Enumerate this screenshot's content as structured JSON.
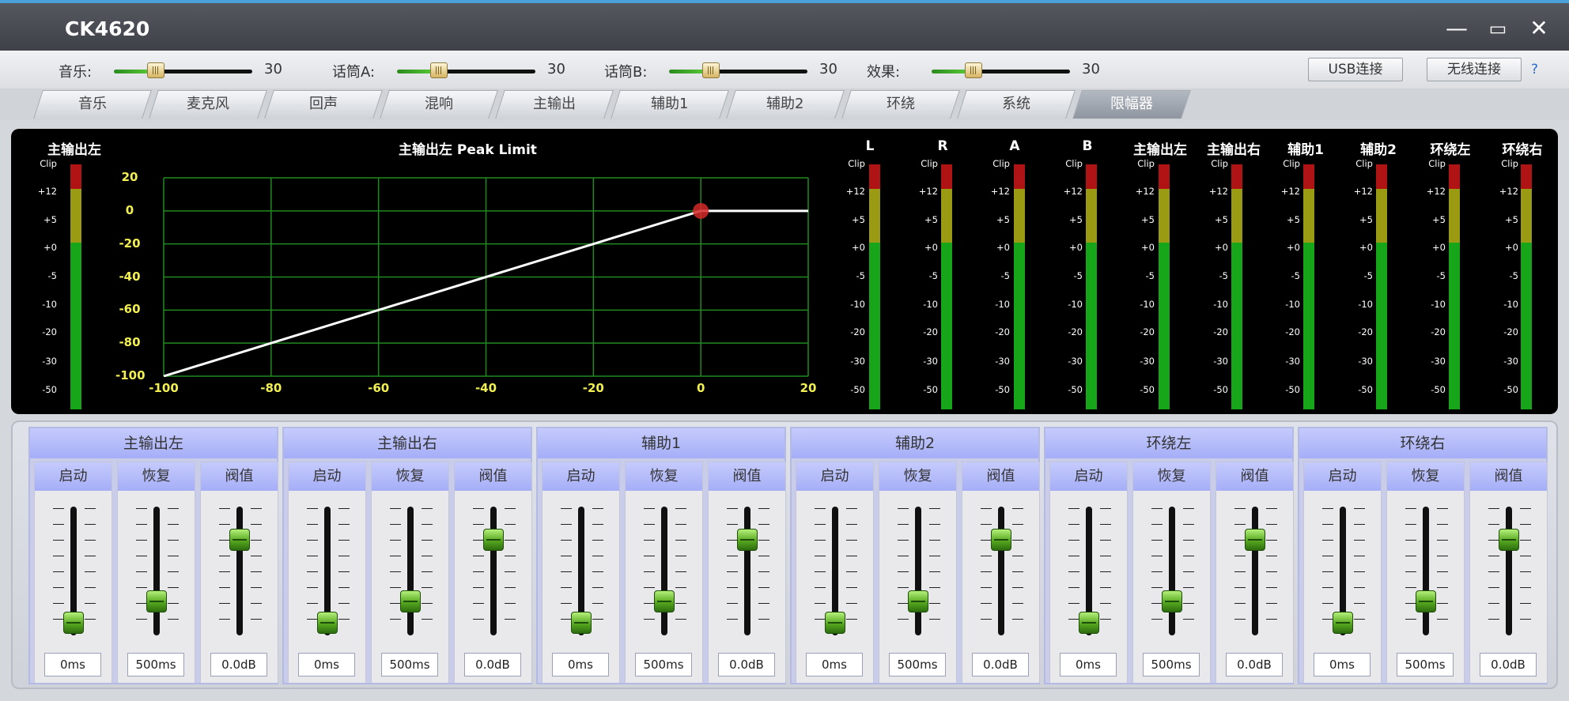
{
  "window": {
    "title": "CK4620",
    "minimize": "—",
    "maximize": "▭",
    "close": "✕"
  },
  "volumes": [
    {
      "label": "音乐:",
      "value": "30",
      "level": 0.3
    },
    {
      "label": "话筒A:",
      "value": "30",
      "level": 0.3
    },
    {
      "label": "话筒B:",
      "value": "30",
      "level": 0.3
    },
    {
      "label": "效果:",
      "value": "30",
      "level": 0.3
    }
  ],
  "buttons": {
    "usb": "USB连接",
    "wireless": "无线连接",
    "help": "?"
  },
  "tabs": [
    "音乐",
    "麦克风",
    "回声",
    "混响",
    "主输出",
    "辅助1",
    "辅助2",
    "环绕",
    "系统",
    "限幅器"
  ],
  "active_tab": "限幅器",
  "graph": {
    "title": "主输出左   Peak Limit",
    "y_ticks": [
      "20",
      "0",
      "-20",
      "-40",
      "-60",
      "-80",
      "-100"
    ],
    "x_ticks": [
      "-100",
      "-80",
      "-60",
      "-40",
      "-20",
      "0",
      "20"
    ],
    "threshold_db": 0,
    "accent": "#ffffff",
    "grid_color": "#1f8a1f"
  },
  "meter_scale": [
    "Clip",
    "+12",
    "+5",
    "+0",
    "-5",
    "-10",
    "-20",
    "-30",
    "-50"
  ],
  "left_meter": {
    "name": "主输出左"
  },
  "meters": [
    "L",
    "R",
    "A",
    "B",
    "主输出左",
    "主输出右",
    "辅助1",
    "辅助2",
    "环绕左",
    "环绕右"
  ],
  "colors": {
    "clip": "#b01313",
    "warn": "#9a9a13",
    "ok": "#17a51a"
  },
  "param_labels": {
    "attack": "启动",
    "release": "恢复",
    "threshold": "阀值"
  },
  "channels": [
    {
      "name": "主输出左",
      "attack": "0ms",
      "release": "500ms",
      "threshold": "0.0dB",
      "attack_pos": 0.0,
      "release_pos": 0.2,
      "threshold_pos": 0.78
    },
    {
      "name": "主输出右",
      "attack": "0ms",
      "release": "500ms",
      "threshold": "0.0dB",
      "attack_pos": 0.0,
      "release_pos": 0.2,
      "threshold_pos": 0.78
    },
    {
      "name": "辅助1",
      "attack": "0ms",
      "release": "500ms",
      "threshold": "0.0dB",
      "attack_pos": 0.0,
      "release_pos": 0.2,
      "threshold_pos": 0.78
    },
    {
      "name": "辅助2",
      "attack": "0ms",
      "release": "500ms",
      "threshold": "0.0dB",
      "attack_pos": 0.0,
      "release_pos": 0.2,
      "threshold_pos": 0.78
    },
    {
      "name": "环绕左",
      "attack": "0ms",
      "release": "500ms",
      "threshold": "0.0dB",
      "attack_pos": 0.0,
      "release_pos": 0.2,
      "threshold_pos": 0.78
    },
    {
      "name": "环绕右",
      "attack": "0ms",
      "release": "500ms",
      "threshold": "0.0dB",
      "attack_pos": 0.0,
      "release_pos": 0.2,
      "threshold_pos": 0.78
    }
  ]
}
